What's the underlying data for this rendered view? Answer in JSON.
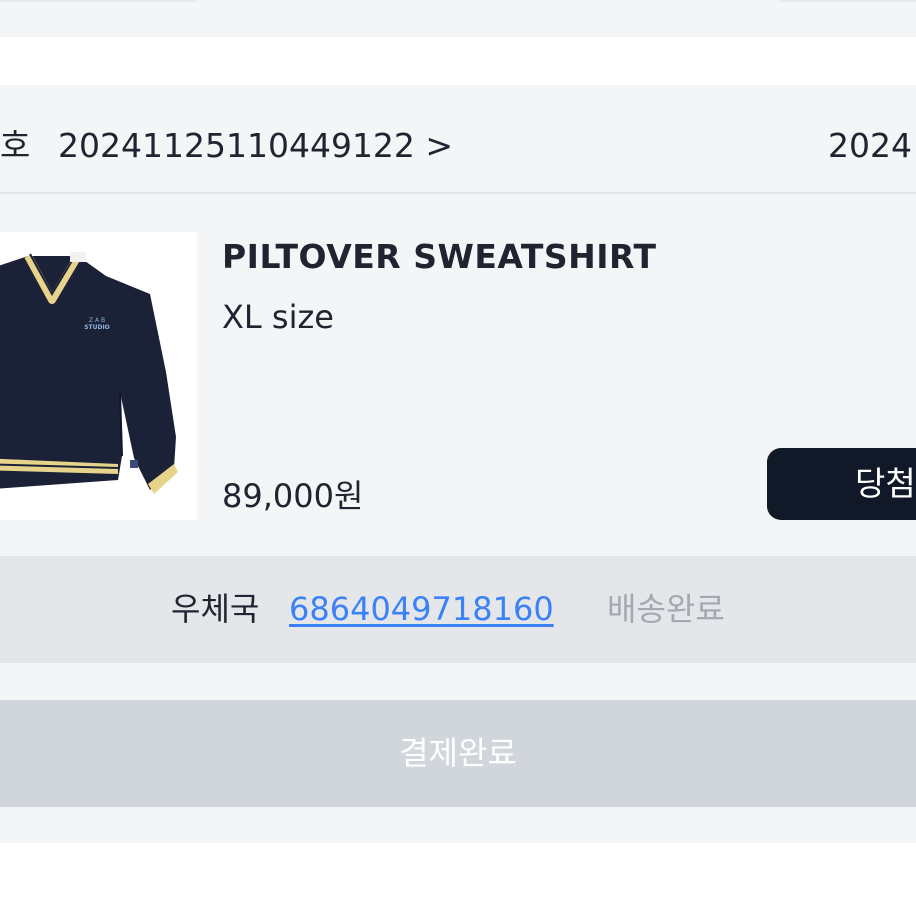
{
  "order": {
    "label_fragment": "호",
    "number": "20241125110449122 >",
    "date_fragment": "2024"
  },
  "product": {
    "name": "PILTOVER SWEATSHIRT",
    "option": "XL size",
    "price": "89,000원",
    "image_logo_lines": [
      "Z A B",
      "STUDIO"
    ]
  },
  "actions": {
    "win_button_label": "당첨",
    "payment_status_label": "결제완료"
  },
  "shipping": {
    "carrier": "우체국",
    "tracking_number": "6864049718160",
    "status": "배송완료"
  },
  "colors": {
    "background": "#f4f5f7",
    "dark_button": "#111827",
    "link": "#3b82f6",
    "muted_text": "#a3a8b1",
    "disabled_button": "#d1d5dc",
    "shipping_bar": "#e4e6ea"
  }
}
